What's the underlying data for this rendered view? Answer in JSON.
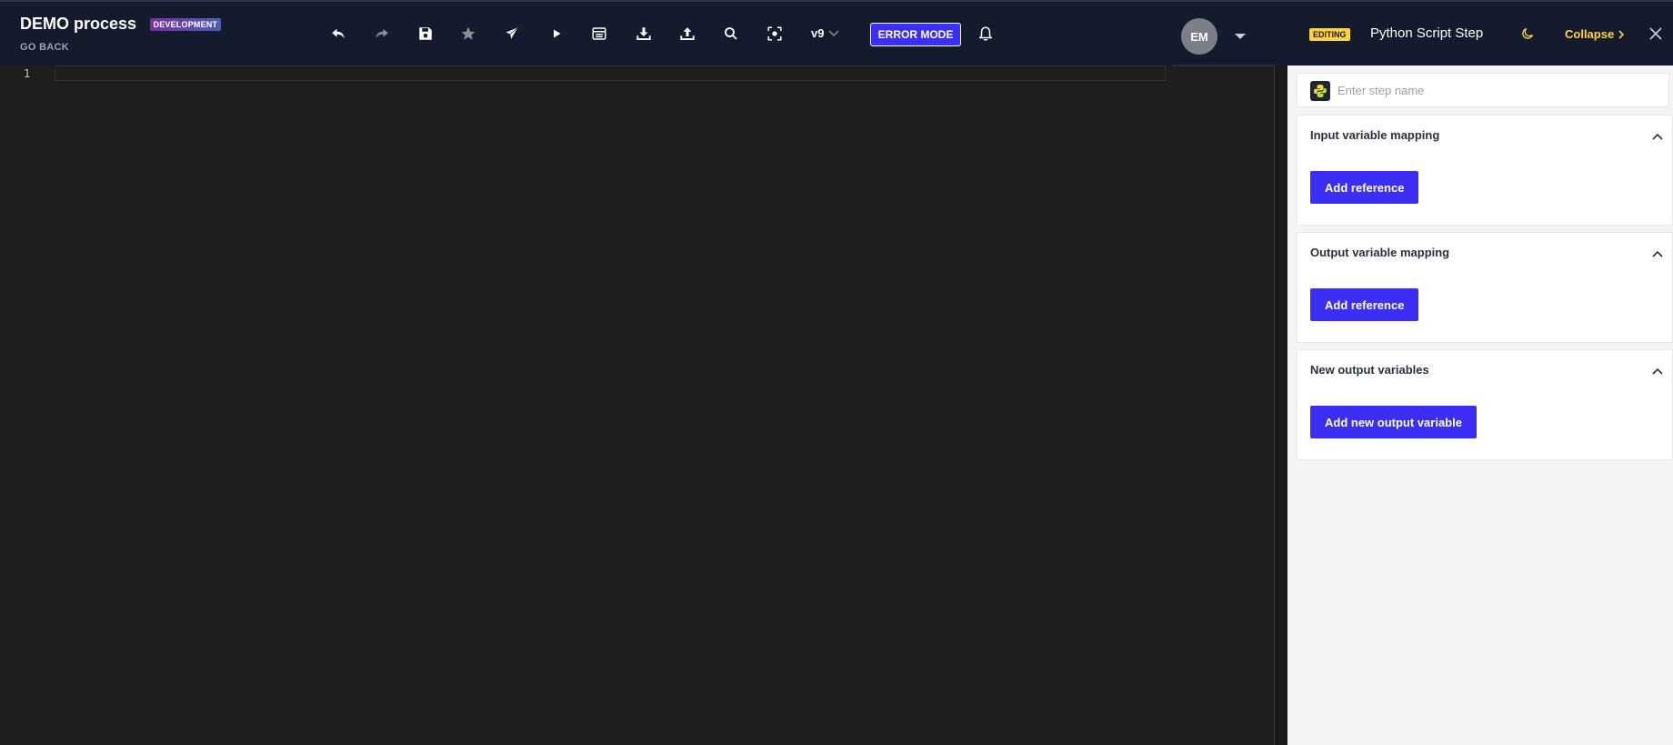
{
  "header": {
    "title": "DEMO process",
    "env_badge": "DEVELOPMENT",
    "go_back": "GO BACK",
    "toolbar": [
      {
        "name": "undo-icon"
      },
      {
        "name": "redo-icon"
      },
      {
        "name": "save-icon"
      },
      {
        "name": "star-icon"
      },
      {
        "name": "send-icon"
      },
      {
        "name": "play-icon"
      },
      {
        "name": "table-icon"
      },
      {
        "name": "download-icon"
      },
      {
        "name": "upload-icon"
      },
      {
        "name": "search-icon"
      },
      {
        "name": "focus-icon"
      }
    ],
    "version": "v9",
    "error_mode": "ERROR MODE",
    "avatar_initials": "EM"
  },
  "editor": {
    "line_number": "1"
  },
  "panel": {
    "editing_badge": "EDITING",
    "title": "Python Script Step",
    "collapse_label": "Collapse",
    "step_name_placeholder": "Enter step name",
    "sections": [
      {
        "title": "Input variable mapping",
        "button": "Add reference"
      },
      {
        "title": "Output variable mapping",
        "button": "Add reference"
      },
      {
        "title": "New output variables",
        "button": "Add new output variable"
      }
    ]
  },
  "colors": {
    "header_bg": "#141b2d",
    "accent": "#3b2ff5",
    "editing_yellow": "#ffd23f",
    "editor_bg": "#1e1e1e"
  }
}
